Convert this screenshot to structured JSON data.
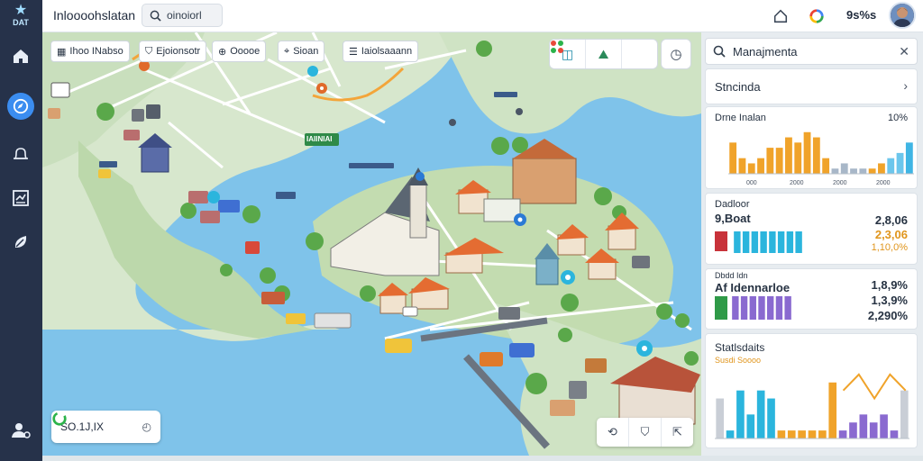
{
  "app": {
    "title": "Inloooohslatan",
    "logo_text": "DAT"
  },
  "search": {
    "value": "oinoiorl",
    "placeholder": "Search"
  },
  "topbar": {
    "count_label": "9s%s"
  },
  "sidebar": {
    "items": [
      {
        "icon": "home-icon",
        "active": false
      },
      {
        "icon": "compass-icon",
        "active": true
      },
      {
        "icon": "bell-icon",
        "active": false
      },
      {
        "icon": "report-icon",
        "active": false
      },
      {
        "icon": "leaf-icon",
        "active": false
      },
      {
        "icon": "user-settings-icon",
        "active": false
      }
    ]
  },
  "map": {
    "filter_chips": [
      {
        "label": "Ihoo INabso",
        "icon": "layers-icon"
      },
      {
        "label": "Ejoionsotr",
        "icon": "filter-icon"
      },
      {
        "label": "Ooooe",
        "icon": "tag-icon"
      },
      {
        "label": "Sioan",
        "icon": "pin-icon"
      },
      {
        "label": "Iaiolsaaann",
        "icon": "list-icon"
      }
    ],
    "status_label": "SO.1J,IX",
    "place_label": "IAIINIAI"
  },
  "panel": {
    "search_value": "Manajmenta",
    "row_label": "Stncinda",
    "card1": {
      "title": "Drne Inalan",
      "value": "10%",
      "x_ticks": [
        "000",
        "2000",
        "2000",
        "2000"
      ],
      "chart_data": {
        "type": "bar",
        "values": [
          6,
          3,
          2,
          3,
          5,
          5,
          7,
          6,
          8,
          7,
          3,
          1,
          2,
          1,
          1,
          1,
          2,
          3,
          4,
          6
        ],
        "colors": [
          "#f0a32a",
          "#f0a32a",
          "#f0a32a",
          "#f0a32a",
          "#f0a32a",
          "#f0a32a",
          "#f0a32a",
          "#f0a32a",
          "#f0a32a",
          "#f0a32a",
          "#f0a32a",
          "#a8b7c8",
          "#a8b7c8",
          "#a8b7c8",
          "#a8b7c8",
          "#f0a32a",
          "#f0a32a",
          "#6cc6ec",
          "#6cc6ec",
          "#3fb5e4"
        ],
        "ylim": [
          0,
          9
        ]
      }
    },
    "card2": {
      "title": "Dadloor",
      "subtitle": "9,Boat",
      "values": [
        "2,8,06",
        "2,3,06",
        "1,10,0%"
      ],
      "chart_data": {
        "type": "bar",
        "values": [
          4,
          4,
          4,
          4,
          4,
          4,
          4,
          4
        ],
        "colors": [
          "#2bb5dd",
          "#2bb5dd",
          "#2bb5dd",
          "#2bb5dd",
          "#2bb5dd",
          "#2bb5dd",
          "#2bb5dd",
          "#2bb5dd"
        ],
        "ylim": [
          0,
          4
        ]
      }
    },
    "card3": {
      "title": "Dbdd Idn",
      "subtitle": "Af Idennarloe",
      "values": [
        "1,8,9%",
        "1,3,9%",
        "2,290%"
      ],
      "chart_data": {
        "type": "bar",
        "values": [
          5,
          5,
          5,
          5,
          5,
          5,
          5
        ],
        "colors": [
          "#8a6ad0",
          "#8a6ad0",
          "#8a6ad0",
          "#8a6ad0",
          "#8a6ad0",
          "#8a6ad0",
          "#8a6ad0"
        ],
        "ylim": [
          0,
          5
        ]
      }
    },
    "card4": {
      "title": "Statlsdaits",
      "subtitle": "Susdi Soooo",
      "chart_data": {
        "type": "bar",
        "series": [
          {
            "values": [
              5,
              1,
              6,
              3,
              6,
              5,
              1,
              1,
              1,
              1,
              1,
              7,
              1,
              2,
              3,
              2,
              3,
              1,
              6
            ]
          }
        ],
        "colors": [
          "#c9ced6",
          "#2bb5dd",
          "#2bb5dd",
          "#2bb5dd",
          "#2bb5dd",
          "#2bb5dd",
          "#f0a32a",
          "#f0a32a",
          "#f0a32a",
          "#f0a32a",
          "#f0a32a",
          "#f0a32a",
          "#8a6ad0",
          "#8a6ad0",
          "#8a6ad0",
          "#8a6ad0",
          "#8a6ad0",
          "#8a6ad0",
          "#c9ced6"
        ],
        "line": [
          6,
          8,
          5,
          8,
          6
        ],
        "ylim": [
          0,
          9
        ]
      }
    }
  },
  "colors": {
    "sidebar": "#26324a",
    "accent": "#3b8df0",
    "water": "#7fc3ea",
    "land": "#cfe3c4"
  }
}
